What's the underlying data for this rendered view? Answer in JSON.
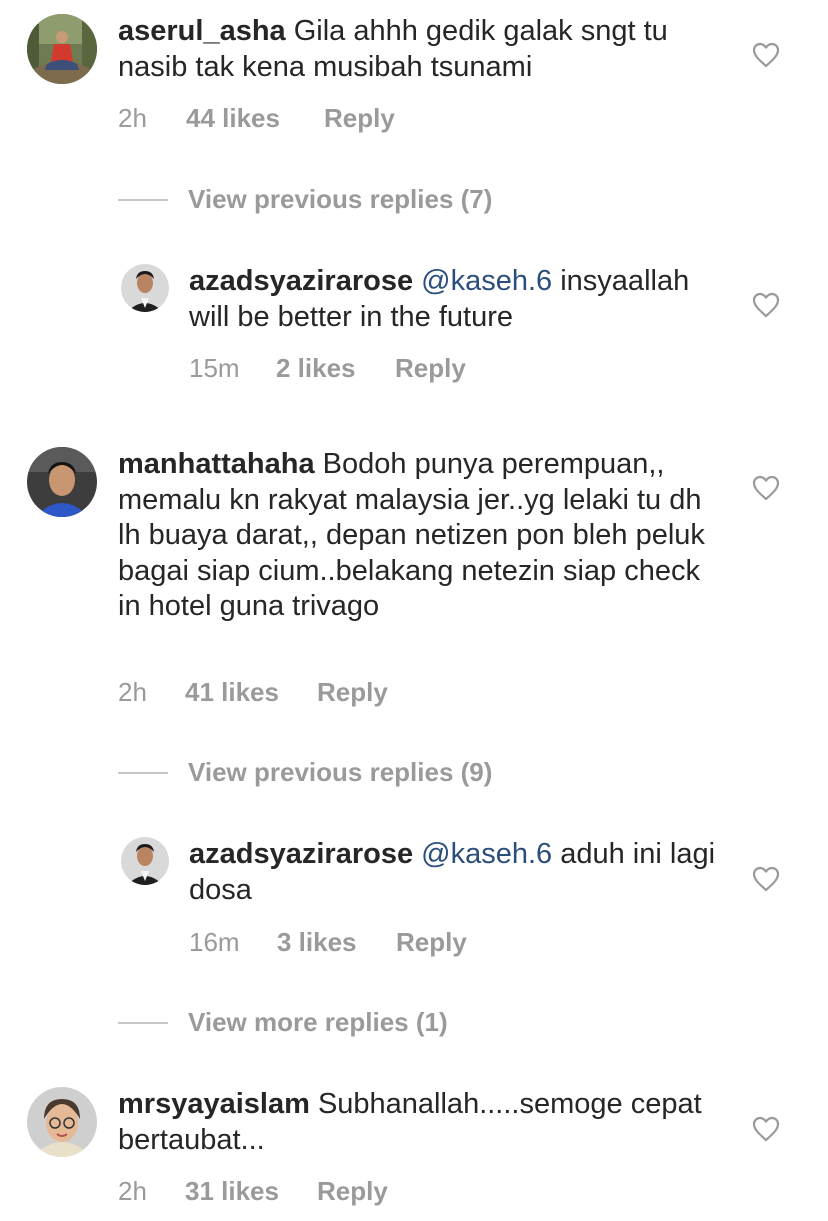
{
  "comments": [
    {
      "username": "aserul_asha",
      "mention": "",
      "text": "Gila ahhh gedik galak sngt tu nasib tak kena musibah tsunami",
      "time": "2h",
      "likes": "44 likes",
      "reply": "Reply",
      "avatar_icon": "avatar-person-outdoors"
    },
    {
      "username": "azadsyazirarose",
      "mention": "@kaseh.6",
      "text": "insyaallah will be better in the future",
      "time": "15m",
      "likes": "2 likes",
      "reply": "Reply",
      "avatar_icon": "avatar-man-suit"
    },
    {
      "username": "manhattahaha",
      "mention": "",
      "text": "Bodoh punya perempuan,, memalu kn rakyat malaysia jer..yg lelaki tu dh lh buaya darat,, depan netizen pon bleh peluk bagai siap cium..belakang netezin siap check in hotel guna trivago",
      "time": "2h",
      "likes": "41 likes",
      "reply": "Reply",
      "avatar_icon": "avatar-man-selfie"
    },
    {
      "username": "azadsyazirarose",
      "mention": "@kaseh.6",
      "text": "aduh ini lagi dosa",
      "time": "16m",
      "likes": "3 likes",
      "reply": "Reply",
      "avatar_icon": "avatar-man-suit"
    },
    {
      "username": "mrsyayaislam",
      "mention": "",
      "text": "Subhanallah.....semoge cepat bertaubat...",
      "time": "2h",
      "likes": "31 likes",
      "reply": "Reply",
      "avatar_icon": "avatar-woman-glasses"
    }
  ],
  "view_replies": [
    "View previous replies (7)",
    "View previous replies (9)",
    "View more replies (1)"
  ],
  "colors": {
    "text": "#262626",
    "meta": "#9a9a9a",
    "mention": "#2b4e7c",
    "divider": "#c7c7c7"
  }
}
